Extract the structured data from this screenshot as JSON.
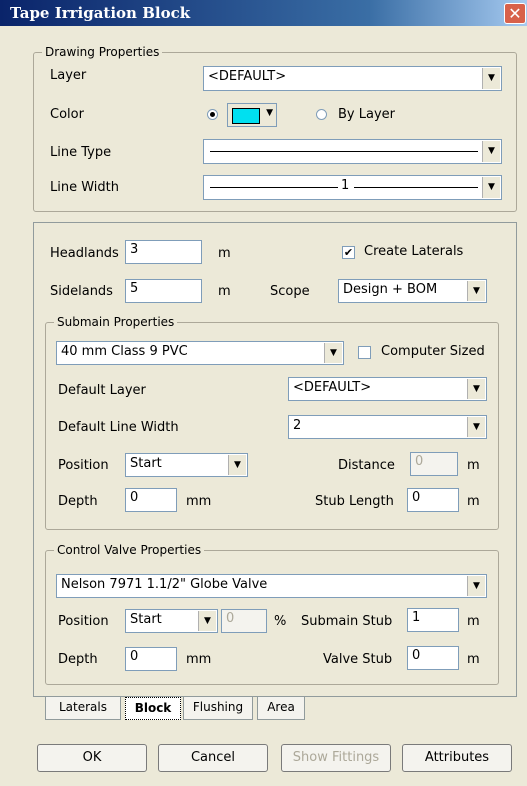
{
  "window": {
    "title": "Tape Irrigation Block",
    "close": "✕"
  },
  "drawing": {
    "group_label": "Drawing Properties",
    "layer_label": "Layer",
    "layer_value": "<DEFAULT>",
    "color_label": "Color",
    "by_layer_label": "By Layer",
    "swatch_color": "#00e0f0",
    "linetype_label": "Line Type",
    "linewidth_label": "Line Width",
    "linewidth_value": "1"
  },
  "block": {
    "headlands_label": "Headlands",
    "headlands_value": "3",
    "headlands_unit": "m",
    "sidelands_label": "Sidelands",
    "sidelands_value": "5",
    "sidelands_unit": "m",
    "create_laterals_label": "Create Laterals",
    "scope_label": "Scope",
    "scope_value": "Design + BOM"
  },
  "submain": {
    "group_label": "Submain Properties",
    "pipe_value": "40 mm Class 9 PVC",
    "computer_sized_label": "Computer Sized",
    "default_layer_label": "Default Layer",
    "default_layer_value": "<DEFAULT>",
    "default_linewidth_label": "Default Line Width",
    "default_linewidth_value": "2",
    "position_label": "Position",
    "position_value": "Start",
    "distance_label": "Distance",
    "distance_value": "0",
    "distance_unit": "m",
    "depth_label": "Depth",
    "depth_value": "0",
    "depth_unit": "mm",
    "stub_length_label": "Stub Length",
    "stub_length_value": "0",
    "stub_length_unit": "m"
  },
  "valve": {
    "group_label": "Control Valve Properties",
    "valve_value": "Nelson 7971 1.1/2\" Globe Valve",
    "position_label": "Position",
    "position_value": "Start",
    "percent_value": "0",
    "percent_unit": "%",
    "submain_stub_label": "Submain Stub",
    "submain_stub_value": "1",
    "submain_stub_unit": "m",
    "depth_label": "Depth",
    "depth_value": "0",
    "depth_unit": "mm",
    "valve_stub_label": "Valve Stub",
    "valve_stub_value": "0",
    "valve_stub_unit": "m"
  },
  "tabs": [
    "Laterals",
    "Block",
    "Flushing",
    "Area"
  ],
  "buttons": {
    "ok": "OK",
    "cancel": "Cancel",
    "show_fittings": "Show Fittings",
    "attributes": "Attributes"
  },
  "icons": {
    "check": "✔",
    "arrow": "▼"
  }
}
